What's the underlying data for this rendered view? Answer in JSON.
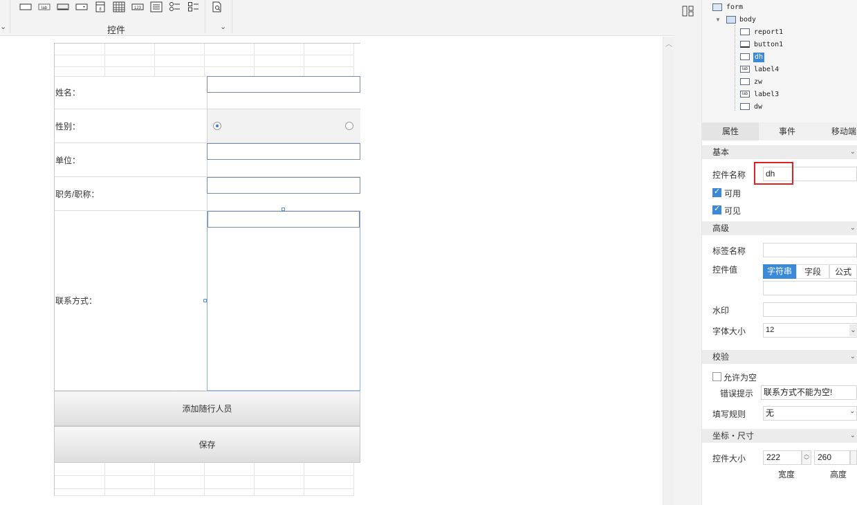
{
  "toolbar": {
    "group_label": "控件",
    "icons": [
      "textbox-icon",
      "label-icon",
      "button-icon",
      "combo-icon",
      "number-spinner-icon",
      "grid-icon",
      "numeric-icon",
      "list-icon",
      "radio-group-icon",
      "checkbox-group-icon",
      "preview-icon"
    ]
  },
  "form": {
    "rows": [
      {
        "label": "姓名：",
        "control": "textbox"
      },
      {
        "label": "性别：",
        "control": "radio"
      },
      {
        "label": "单位：",
        "control": "textbox"
      },
      {
        "label": "职务/职称：",
        "control": "textbox"
      },
      {
        "label": "联系方式：",
        "control": "textbox"
      }
    ],
    "add_button": "添加随行人员",
    "save_button": "保存"
  },
  "tree": {
    "root": "form",
    "body": "body",
    "children": [
      "report1",
      "button1",
      "dh",
      "label4",
      "zw",
      "label3",
      "dw"
    ],
    "selected": "dh"
  },
  "tabs": [
    "属性",
    "事件",
    "移动端"
  ],
  "properties": {
    "basic": {
      "section": "基本",
      "name_label": "控件名称",
      "name_value": "dh",
      "enabled_label": "可用",
      "visible_label": "可见"
    },
    "advanced": {
      "section": "高级",
      "tag_label": "标签名称",
      "value_label": "控件值",
      "value_modes": [
        "字符串",
        "字段",
        "公式"
      ],
      "watermark_label": "水印",
      "font_size_label": "字体大小",
      "font_size_value": "12"
    },
    "validation": {
      "section": "校验",
      "allow_empty_label": "允许为空",
      "error_label": "错误提示",
      "error_value": "联系方式不能为空!",
      "rule_label": "填写规则",
      "rule_value": "无"
    },
    "geometry": {
      "section": "坐标・尺寸",
      "size_label": "控件大小",
      "width_value": "222",
      "height_value": "260",
      "width_label": "宽度",
      "height_label": "高度"
    }
  },
  "colors": {
    "accent": "#3c89d8",
    "highlight_box": "#e02020",
    "selection": "#5a8ee0"
  }
}
